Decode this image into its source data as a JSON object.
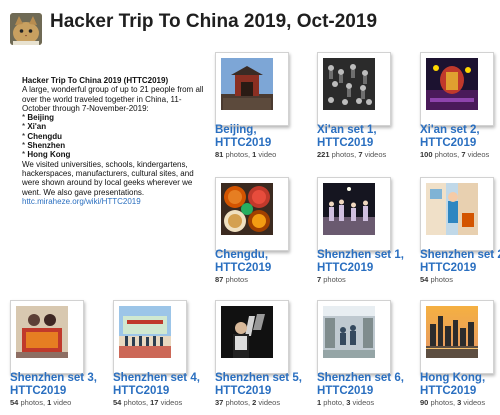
{
  "header": {
    "title": "Hacker Trip To China 2019, Oct-2019",
    "avatar_icon": "cat-avatar-icon"
  },
  "description": {
    "title": "Hacker Trip To China 2019 (HTTC2019)",
    "intro": "A large, wonderful group of up to 21 people from all over the world traveled together in China, 11-October through 7-November-2019:",
    "cities": [
      "Beijing",
      "Xi'an",
      "Chengdu",
      "Shenzhen",
      "Hong Kong"
    ],
    "outro": "We visited universities, schools, kindergartens, hackerspaces, manufacturers, cultural sites, and were shown around by local geeks wherever we went. We also gave presentations.",
    "link": "httc.miraheze.org/wiki/HTTC2019"
  },
  "albums": [
    {
      "title": "Beijing, HTTC2019",
      "count": "81",
      "count_label": "photos,",
      "video": "1",
      "video_label": "video"
    },
    {
      "title": "Xi'an set 1, HTTC2019",
      "count": "221",
      "count_label": "photos,",
      "video": "7",
      "video_label": "videos"
    },
    {
      "title": "Xi'an set 2, HTTC2019",
      "count": "100",
      "count_label": "photos,",
      "video": "7",
      "video_label": "videos"
    },
    {
      "title": "Chengdu, HTTC2019",
      "count": "87",
      "count_label": "photos",
      "video": "",
      "video_label": ""
    },
    {
      "title": "Shenzhen set 1, HTTC2019",
      "count": "7",
      "count_label": "photos",
      "video": "",
      "video_label": ""
    },
    {
      "title": "Shenzhen set 2, HTTC2019",
      "count": "54",
      "count_label": "photos",
      "video": "",
      "video_label": ""
    },
    {
      "title": "Shenzhen set 3, HTTC2019",
      "count": "54",
      "count_label": "photos,",
      "video": "1",
      "video_label": "video"
    },
    {
      "title": "Shenzhen set 4, HTTC2019",
      "count": "54",
      "count_label": "photos,",
      "video": "17",
      "video_label": "videos"
    },
    {
      "title": "Shenzhen set 5, HTTC2019",
      "count": "37",
      "count_label": "photos,",
      "video": "2",
      "video_label": "videos"
    },
    {
      "title": "Shenzhen set 6, HTTC2019",
      "count": "1",
      "count_label": "photo,",
      "video": "3",
      "video_label": "videos"
    },
    {
      "title": "Hong Kong, HTTC2019",
      "count": "90",
      "count_label": "photos,",
      "video": "3",
      "video_label": "videos"
    }
  ]
}
